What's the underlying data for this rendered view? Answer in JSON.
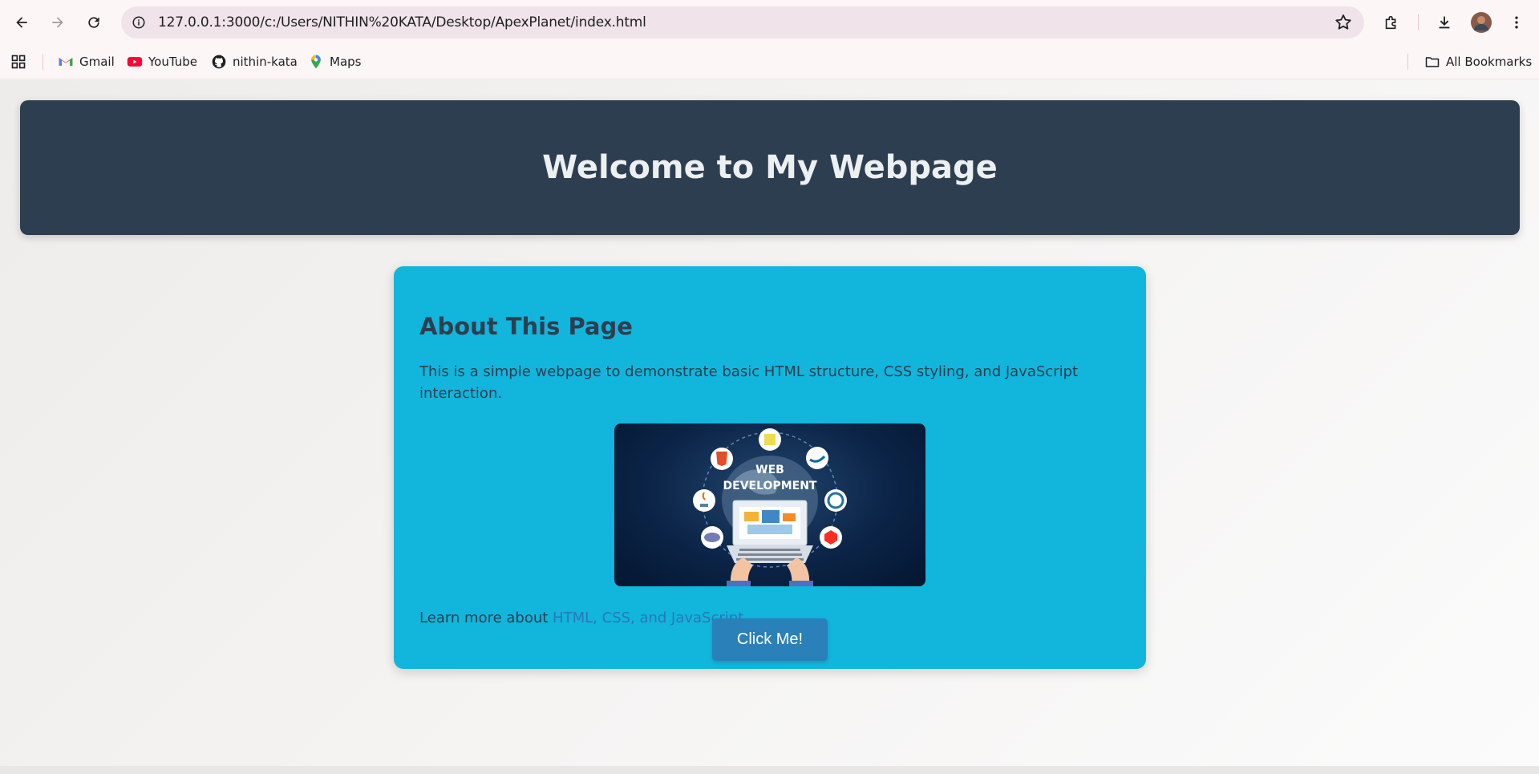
{
  "browser": {
    "url": "127.0.0.1:3000/c:/Users/NITHIN%20KATA/Desktop/ApexPlanet/index.html",
    "bookmarks": [
      {
        "label": "Gmail",
        "icon": "gmail-icon"
      },
      {
        "label": "YouTube",
        "icon": "youtube-icon"
      },
      {
        "label": "nithin-kata",
        "icon": "github-icon"
      },
      {
        "label": "Maps",
        "icon": "maps-icon"
      }
    ],
    "all_bookmarks_label": "All Bookmarks"
  },
  "page": {
    "header_title": "Welcome to My Webpage",
    "section_title": "About This Page",
    "section_text": "This is a simple webpage to demonstrate basic HTML structure, CSS styling, and JavaScript interaction.",
    "hero_image": {
      "title_line1": "WEB",
      "title_line2": "DEVELOPMENT"
    },
    "learn_prefix": "Learn more about ",
    "learn_link": "HTML, CSS, and JavaScript",
    "learn_suffix": ".",
    "button_label": "Click Me!"
  },
  "colors": {
    "header_bg": "#2e3e51",
    "card_bg": "#12b5dc",
    "link": "#2879b5",
    "button_bg": "#2a80b9"
  }
}
